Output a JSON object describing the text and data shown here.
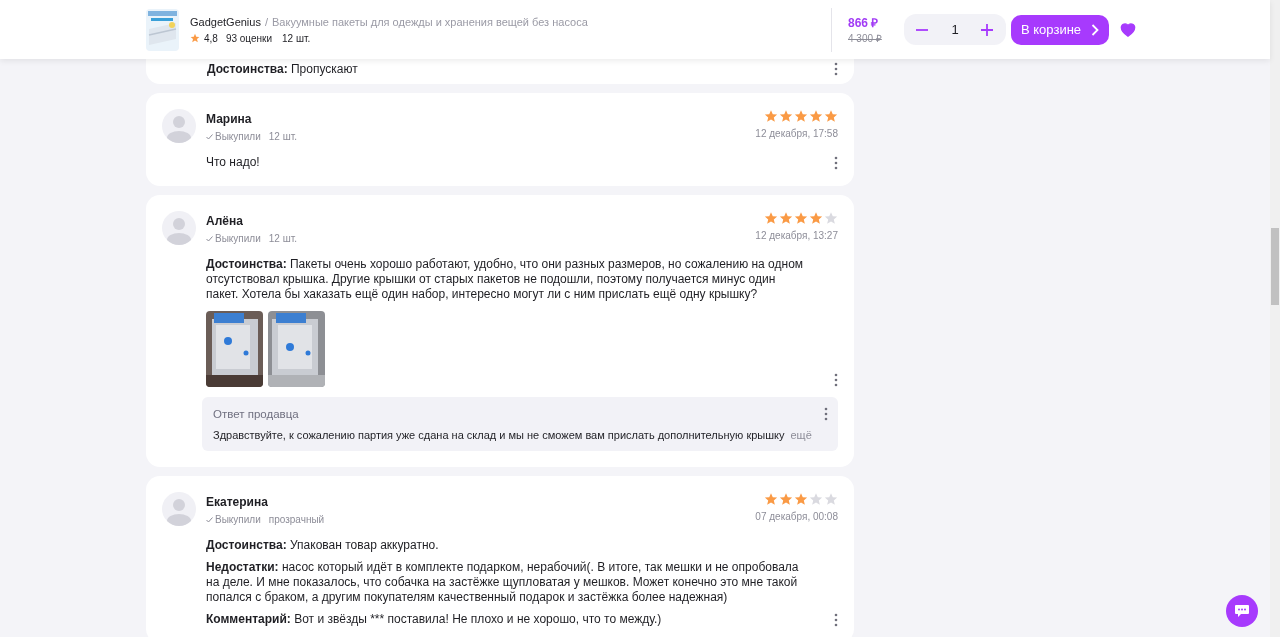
{
  "header": {
    "brand": "GadgetGenius",
    "separator": "/",
    "title": "Вакуумные пакеты для одежды и хранения вещей без насоса",
    "rating": "4,8",
    "ratings_count": "93 оценки",
    "variant": "12 шт.",
    "price": "866 ₽",
    "old_price": "4 300 ₽",
    "quantity": "1",
    "cart_button": "В корзине",
    "favorite": true
  },
  "partial_review": {
    "sections": [
      "**Достоинства:** Пропускают"
    ]
  },
  "reviews": [
    {
      "name": "Марина",
      "purchased": "Выкупили",
      "variant": "12 шт.",
      "date": "12 декабря, 17:58",
      "stars": 5,
      "sections": [
        "Что надо!"
      ]
    },
    {
      "name": "Алёна",
      "purchased": "Выкупили",
      "variant": "12 шт.",
      "date": "12 декабря, 13:27",
      "stars": 4,
      "sections": [
        "**Достоинства:** Пакеты очень хорошо работают, удобно, что они разных размеров, но сожалению на одном отсутствовал крышка. Другие крышки от старых пакетов не подошли, поэтому получается минус один пакет. Хотела бы хаказать ещё один набор, интересно могут ли с ним прислать ещё одну крышку?"
      ],
      "photos": [
        {
          "kind": "picture"
        },
        {
          "kind": "picture"
        }
      ],
      "seller_reply": {
        "title": "Ответ продавца",
        "text": "Здравствуйте, к сожалению партия уже сдана на склад и мы не сможем вам прислать дополнительную крышку",
        "more": "ещё"
      }
    },
    {
      "name": "Екатерина",
      "purchased": "Выкупили",
      "variant": "прозрачный",
      "date": "07 декабря, 00:08",
      "stars": 3,
      "sections": [
        "**Достоинства:** Упакован товар аккуратно.",
        "**Недостатки:** насос который идёт в комплекте подарком, нерабочий(. В итоге, так мешки и не опробовала на деле. И мне показалось, что собачка на застёжке щупловатая у мешков. Может конечно это мне такой попался с браком, а другим покупателям качественный подарок и застёжка более надежная)",
        "**Комментарий:** Вот и звёзды *** поставила! Не плохо и не хорошо, что то между.)"
      ]
    }
  ]
}
